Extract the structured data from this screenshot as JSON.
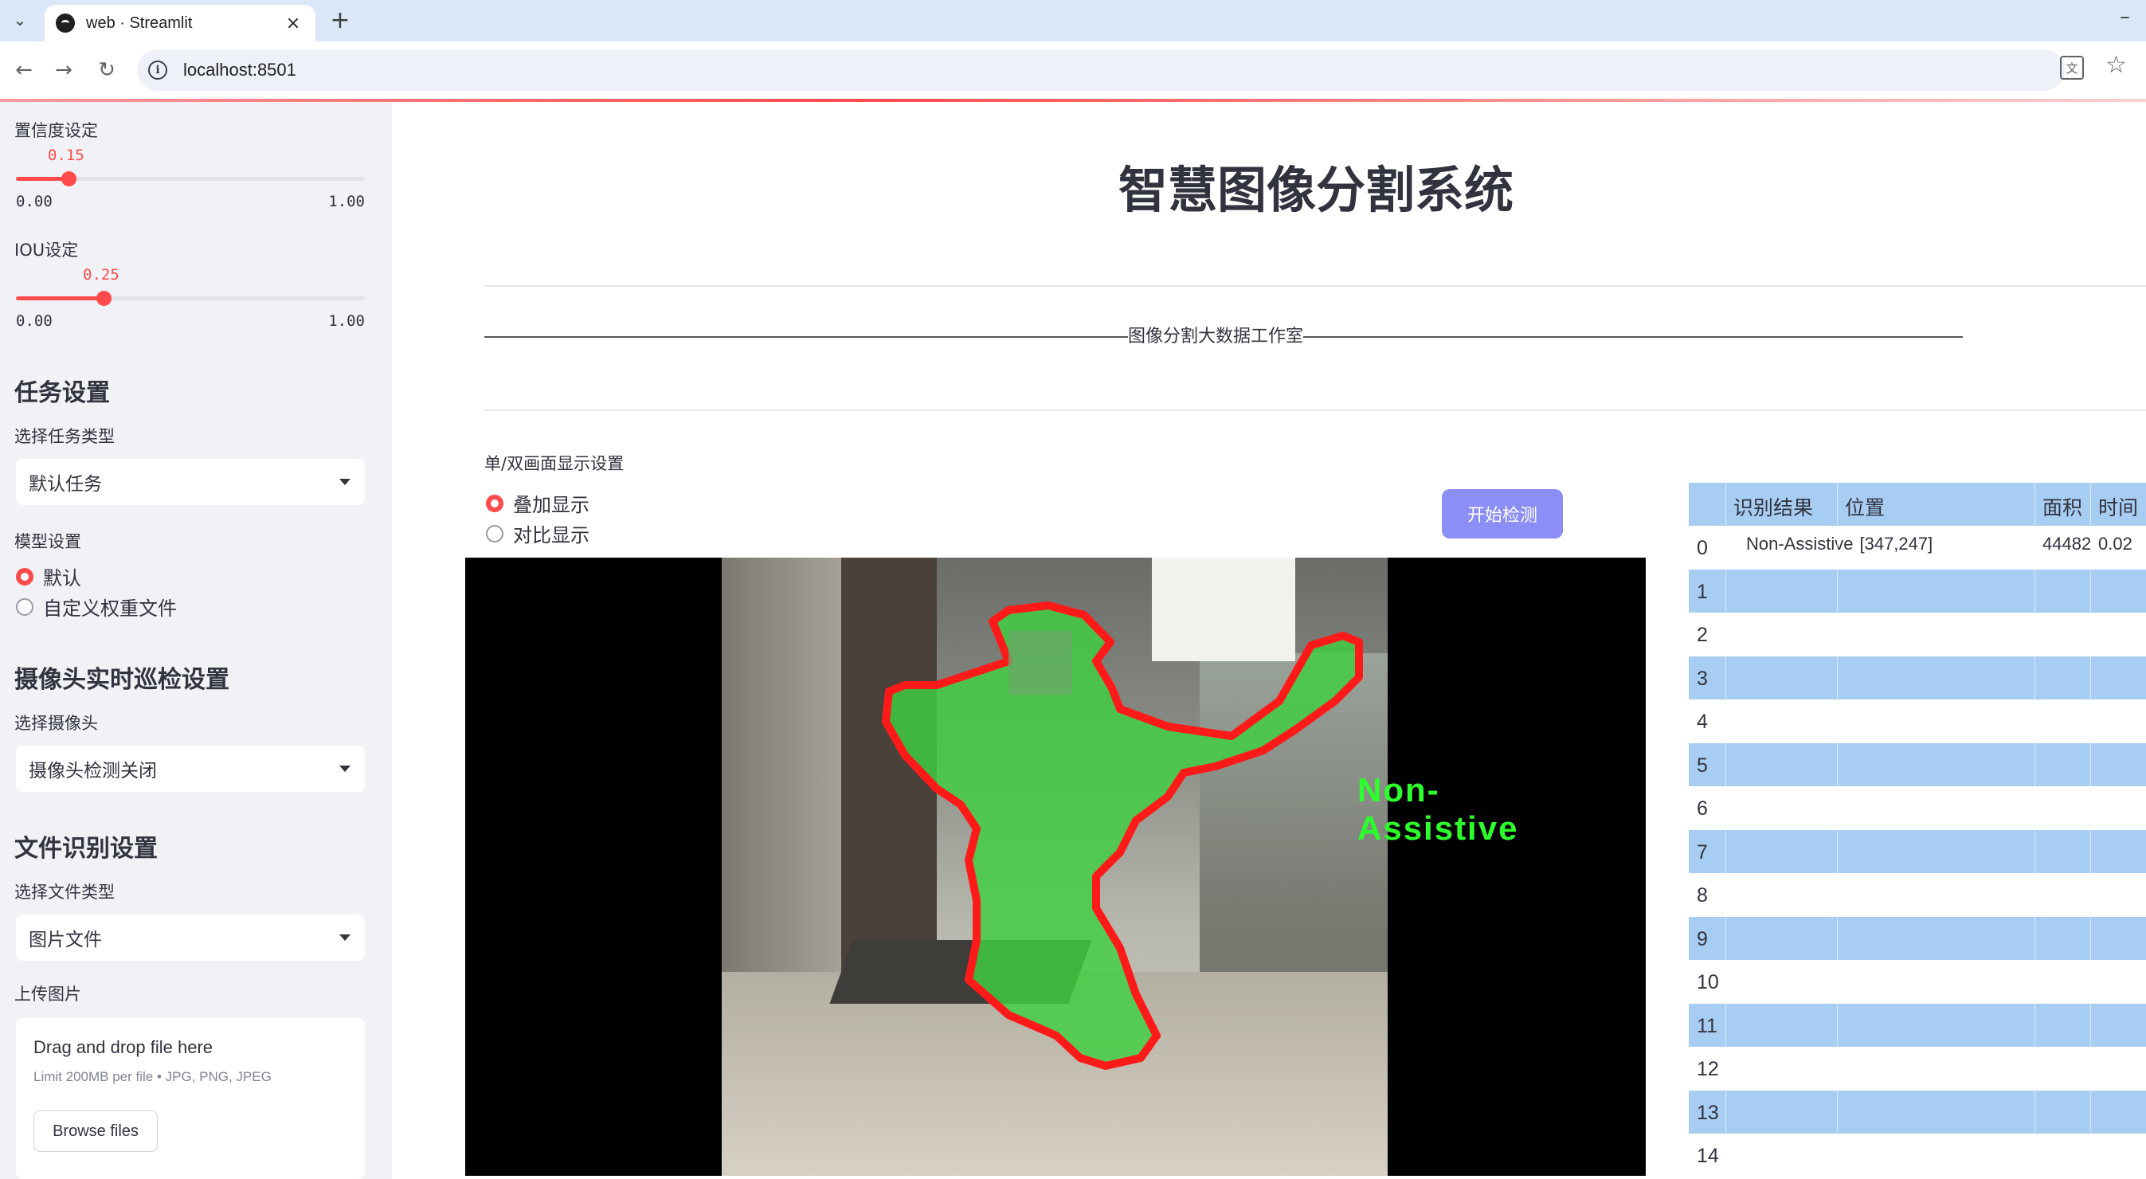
{
  "browser": {
    "tab_title": "web · Streamlit",
    "url": "localhost:8501"
  },
  "sidebar": {
    "confidence": {
      "label": "置信度设定",
      "value": "0.15",
      "fraction": 0.15,
      "min": "0.00",
      "max": "1.00"
    },
    "iou": {
      "label": "IOU设定",
      "value": "0.25",
      "fraction": 0.25,
      "min": "0.00",
      "max": "1.00"
    },
    "task": {
      "heading": "任务设置",
      "select_label": "选择任务类型",
      "selected": "默认任务"
    },
    "model": {
      "label": "模型设置",
      "options": [
        "默认",
        "自定义权重文件"
      ],
      "selected_index": 0
    },
    "camera": {
      "heading": "摄像头实时巡检设置",
      "select_label": "选择摄像头",
      "selected": "摄像头检测关闭"
    },
    "file": {
      "heading": "文件识别设置",
      "select_label": "选择文件类型",
      "selected": "图片文件"
    },
    "upload": {
      "label": "上传图片",
      "title": "Drag and drop file here",
      "limit": "Limit 200MB per file • JPG, PNG, JPEG",
      "button": "Browse files"
    }
  },
  "main": {
    "title": "智慧图像分割系统",
    "banner_text": "图像分割大数据工作室",
    "display_label": "单/双画面显示设置",
    "display_options": [
      "叠加显示",
      "对比显示"
    ],
    "display_selected_index": 0,
    "start_button": "开始检测",
    "detection_label": "Non-Assistive"
  },
  "results": {
    "columns": [
      "",
      "识别结果",
      "位置",
      "面积",
      "时间"
    ],
    "rows": [
      {
        "index": "0",
        "result": "Non-Assistive",
        "position": "[347,247]",
        "area": "44482",
        "time": "0.02"
      },
      {
        "index": "1"
      },
      {
        "index": "2"
      },
      {
        "index": "3"
      },
      {
        "index": "4"
      },
      {
        "index": "5"
      },
      {
        "index": "6"
      },
      {
        "index": "7"
      },
      {
        "index": "8"
      },
      {
        "index": "9"
      },
      {
        "index": "10"
      },
      {
        "index": "11"
      },
      {
        "index": "12"
      },
      {
        "index": "13"
      },
      {
        "index": "14"
      }
    ]
  },
  "colors": {
    "accent": "#ff4b4b",
    "sidebar_bg": "#f0f2f6",
    "table_stripe": "#a8cdf2",
    "button": "#8b8ef5",
    "mask_fill": "#3fcf3f",
    "mask_outline": "#ff1a1a"
  }
}
